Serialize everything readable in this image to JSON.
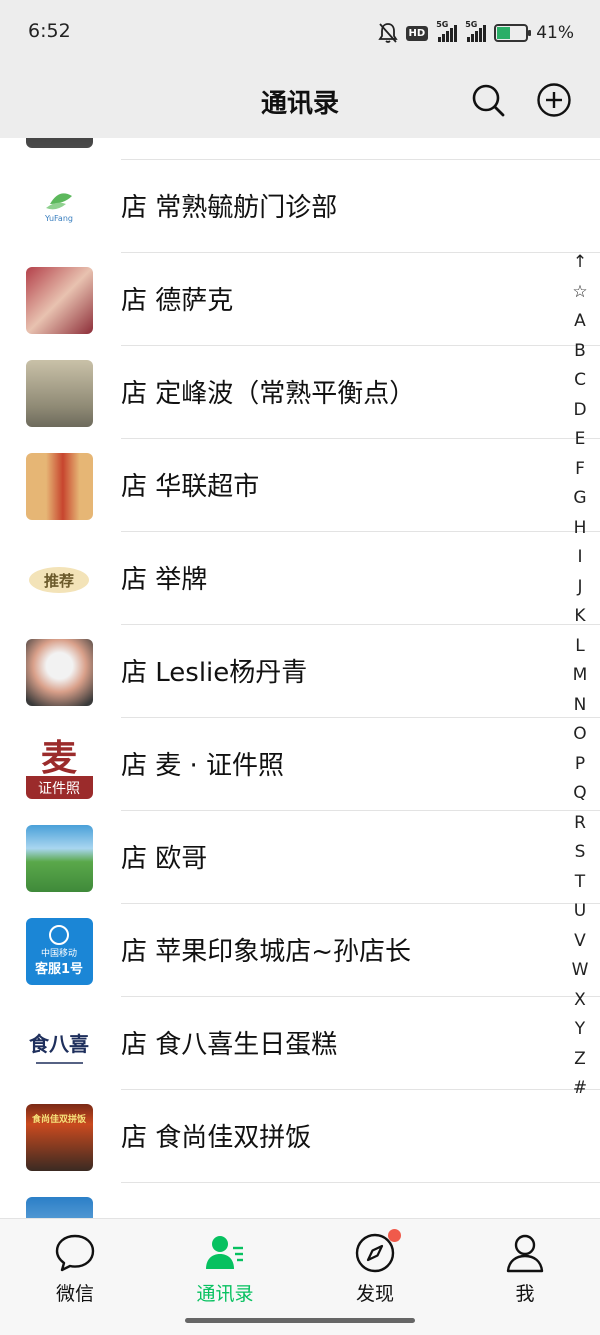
{
  "status": {
    "time": "6:52",
    "hd_badge": "HD",
    "net1": "5G",
    "net2": "5G",
    "battery": "41%",
    "battery_level": 0.41
  },
  "header": {
    "title": "通讯录",
    "search_icon": "search-icon",
    "add_icon": "plus-circle-icon"
  },
  "contacts": [
    {
      "name": "",
      "avatar_colors": [
        "#2b2b2b",
        "#4a4a4a"
      ]
    },
    {
      "name": "店 常熟毓舫门诊部",
      "avatar_text": "YuFang",
      "avatar_colors": [
        "#ffffff",
        "#ffffff"
      ]
    },
    {
      "name": "店 德萨克",
      "avatar_colors": [
        "#b3404a",
        "#e8c2b0"
      ]
    },
    {
      "name": "店 定峰波（常熟平衡点）",
      "avatar_colors": [
        "#c9c1a8",
        "#6d6a5c"
      ]
    },
    {
      "name": "店 华联超市",
      "avatar_colors": [
        "#e6b675",
        "#c7452e"
      ]
    },
    {
      "name": "店 举牌",
      "avatar_text": "推荐",
      "avatar_colors": [
        "#ffffff",
        "#f3e3b8"
      ]
    },
    {
      "name": "店 Leslie杨丹青",
      "avatar_colors": [
        "#d9a08a",
        "#3a3a3a"
      ]
    },
    {
      "name": "店  麦 · 证件照",
      "avatar_text": "麦",
      "avatar_sub": "证件照",
      "avatar_colors": [
        "#ffffff",
        "#9b2b2b"
      ]
    },
    {
      "name": "店 欧哥",
      "avatar_colors": [
        "#4aa0d8",
        "#3f8a3a"
      ]
    },
    {
      "name": "店  苹果印象城店~孙店长",
      "avatar_text": "中国移动",
      "avatar_sub": "客服1号",
      "avatar_colors": [
        "#1b86d6",
        "#1b86d6"
      ]
    },
    {
      "name": "店 食八喜生日蛋糕",
      "avatar_text": "食八喜",
      "avatar_colors": [
        "#ffffff",
        "#ffffff"
      ]
    },
    {
      "name": "店 食尚佳双拼饭",
      "avatar_text": "食尚佳双拼饭",
      "avatar_colors": [
        "#7a2a16",
        "#c94a1f"
      ]
    },
    {
      "name": "",
      "avatar_colors": [
        "#2b7fc7",
        "#9ec9ea"
      ]
    }
  ],
  "index_letters": [
    "↑",
    "☆",
    "A",
    "B",
    "C",
    "D",
    "E",
    "F",
    "G",
    "H",
    "I",
    "J",
    "K",
    "L",
    "M",
    "N",
    "O",
    "P",
    "Q",
    "R",
    "S",
    "T",
    "U",
    "V",
    "W",
    "X",
    "Y",
    "Z",
    "#"
  ],
  "tabs": [
    {
      "label": "微信",
      "icon": "chat-bubble-icon",
      "active": false
    },
    {
      "label": "通讯录",
      "icon": "contacts-icon",
      "active": true
    },
    {
      "label": "发现",
      "icon": "compass-icon",
      "active": false,
      "badge": "red-dot"
    },
    {
      "label": "我",
      "icon": "person-icon",
      "active": false
    }
  ],
  "colors": {
    "accent": "#07c160",
    "header_bg": "#ededed",
    "badge": "#f05a4b"
  }
}
